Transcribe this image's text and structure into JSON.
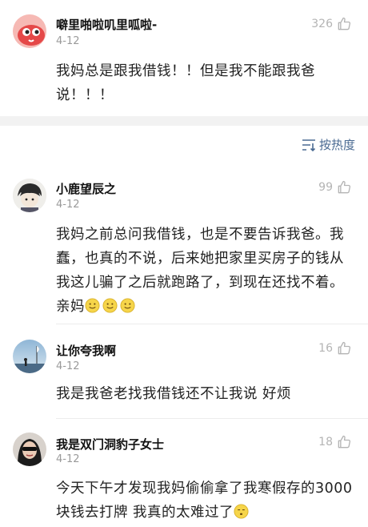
{
  "top_comment": {
    "username": "噼里啪啦叽里呱啦-",
    "date": "4-12",
    "likes": "326",
    "text": "我妈总是跟我借钱！！但是我不能跟我爸说！！！"
  },
  "sort": {
    "label": "按热度",
    "icon": "sort-lines-icon"
  },
  "comments": [
    {
      "username": "小鹿望辰之",
      "date": "4-12",
      "likes": "99",
      "text": "我妈之前总问我借钱，也是不要告诉我爸。我蠢，也真的不说，后来她把家里买房子的钱从我这儿骗了之后就跑路了，到现在还找不着。亲妈"
    },
    {
      "username": "让你夸我啊",
      "date": "4-12",
      "likes": "16",
      "text": "我是我爸老找我借钱还不让我说 好烦"
    },
    {
      "username": "我是双门洞豹子女士",
      "date": "4-12",
      "likes": "18",
      "text": "今天下午才发现我妈偷偷拿了我寒假存的3000块钱去打牌 我真的太难过了"
    }
  ],
  "colors": {
    "link": "#4a6a92",
    "muted": "#9a9a9a",
    "like": "#b4b4b4"
  }
}
